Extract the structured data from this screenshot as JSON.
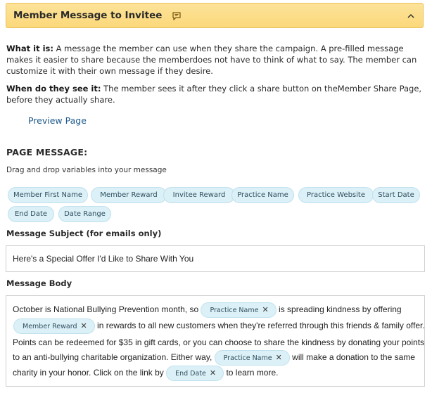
{
  "header": {
    "title": "Member Message to Invitee"
  },
  "info": {
    "what_label": "What it is:",
    "what_text": " A message the member can use when they share the campaign. A pre-filled message makes it easier to share because the memberdoes not have to think of what to say. The member can customize it with their own message if they desire.",
    "when_label": "When do they see it:",
    "when_text": " The member sees it after they click a share button on theMember Share Page, before they actually share."
  },
  "preview_link": "Preview Page",
  "page_message": {
    "title": "PAGE MESSAGE:",
    "hint": "Drag and drop variables into your message"
  },
  "variables": [
    "Member First Name",
    "Member Reward",
    "Invitee Reward",
    "Practice Name",
    "Practice Website",
    "Start Date",
    "End Date",
    "Date Range"
  ],
  "subject": {
    "label": "Message Subject (for emails only)",
    "value": "Here's a Special Offer I'd Like to Share With You"
  },
  "body": {
    "label": "Message Body",
    "line1_a": "October is National Bullying Prevention month, so ",
    "chip_practice_1": "Practice Name",
    "line1_b": " is spreading kindness by offering",
    "chip_member_reward": "Member Reward",
    "line2": " in rewards to all new customers when they're referred through this friends & family offer.",
    "line3": "Points can be redeemed for $35 in gift cards, or you can choose to share the kindness by donating your points",
    "line4_a": "to an anti-bullying charitable organization. Either way, ",
    "chip_practice_2": "Practice Name",
    "line4_b": " will make a donation to the same",
    "line5_a": "charity in your honor. Click on the link by ",
    "chip_end_date": "End Date",
    "line5_b": " to learn more."
  },
  "colors": {
    "header_bg": "#fbd87a",
    "chip_bg": "#dcf0f7",
    "link": "#1f5a8c"
  }
}
